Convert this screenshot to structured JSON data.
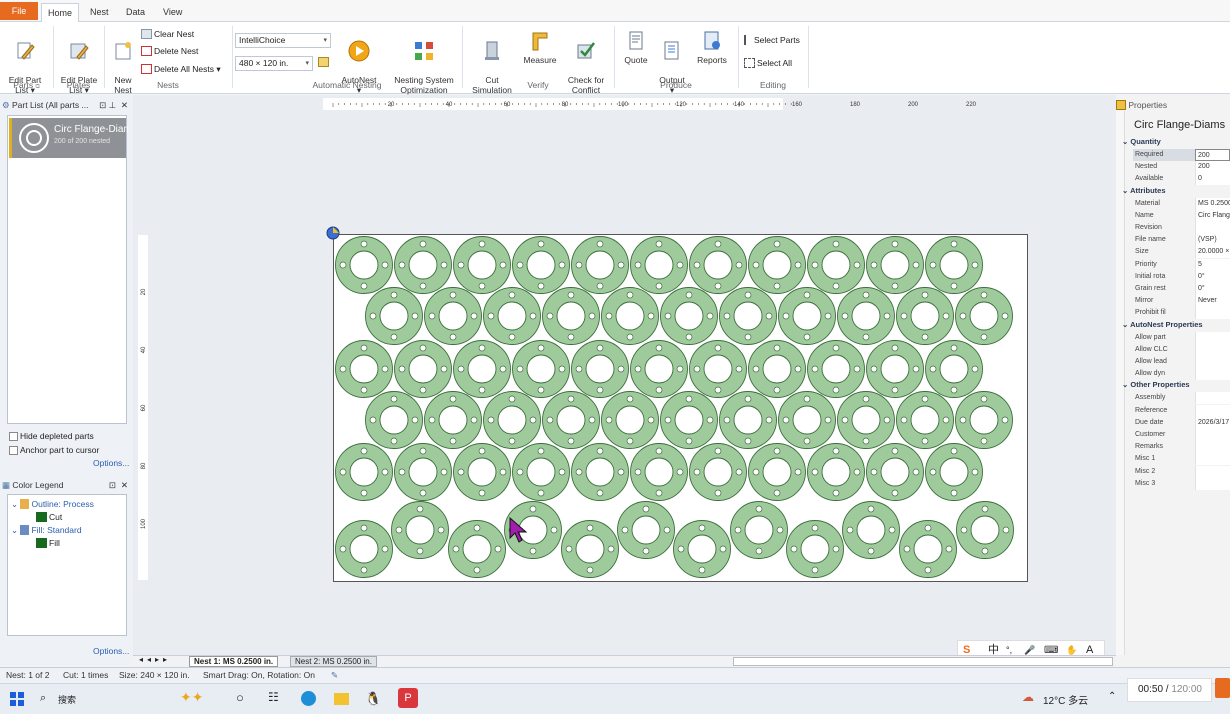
{
  "tabs": {
    "file": "File",
    "home": "Home",
    "nest": "Nest",
    "data": "Data",
    "view": "View"
  },
  "ribbon": {
    "edit_part": "Edit Part\nList ▾",
    "edit_plate": "Edit Plate\nList ▾",
    "new_nest": "New\nNest",
    "clear_nest": "Clear Nest",
    "delete_nest": "Delete Nest",
    "delete_all": "Delete All Nests",
    "strategy": "IntelliChoice",
    "sheet_size": "480 × 120 in.",
    "autonest": "AutoNest\n▾",
    "nesting_opt": "Nesting System\nOptimization",
    "cut_sim": "Cut\nSimulation",
    "measure": "Measure",
    "check_conflict": "Check for\nConflict",
    "quote": "Quote",
    "output": "Output\n▾",
    "reports": "Reports",
    "select_parts": "Select Parts",
    "select_all": "Select All",
    "groups": {
      "parts": "Parts",
      "plates": "Plates",
      "nests": "Nests",
      "automatic": "Automatic Nesting",
      "verify": "Verify",
      "produce": "Produce",
      "editing": "Editing"
    }
  },
  "part_list": {
    "title": "Part List  (All parts ...",
    "item_name": "Circ Flange-Diam",
    "item_status": "200 of 200 nested",
    "hide_depleted": "Hide depleted parts",
    "anchor": "Anchor part to cursor",
    "options": "Options..."
  },
  "legend": {
    "title": "Color Legend",
    "outline": "Outline: Process",
    "cut": "Cut",
    "fill": "Fill: Standard",
    "fill_item": "Fill",
    "options": "Options..."
  },
  "ruler": {
    "x_ticks": [
      "20",
      "40",
      "60",
      "80",
      "100",
      "120",
      "140",
      "160",
      "180",
      "200",
      "220"
    ],
    "y_ticks": [
      "20",
      "40",
      "60",
      "80",
      "100"
    ]
  },
  "properties": {
    "header": "Properties",
    "part_name": "Circ Flange-Diams",
    "sections": [
      {
        "title": "Quantity",
        "rows": [
          [
            "Required",
            "200"
          ],
          [
            "Nested",
            "200"
          ],
          [
            "Available",
            "0"
          ]
        ]
      },
      {
        "title": "Attributes",
        "rows": [
          [
            "Material",
            "MS 0.2500"
          ],
          [
            "Name",
            "Circ Flange"
          ],
          [
            "Revision",
            ""
          ],
          [
            "File name",
            "(VSP)"
          ],
          [
            "Size",
            "20.0000 ×"
          ],
          [
            "Priority",
            "5"
          ],
          [
            "Initial rota",
            "0°"
          ],
          [
            "Grain rest",
            "0°"
          ],
          [
            "Mirror",
            "Never"
          ],
          [
            "Prohibit fil",
            ""
          ]
        ]
      },
      {
        "title": "AutoNest Properties",
        "rows": [
          [
            "Allow part",
            ""
          ],
          [
            "Allow CLC",
            ""
          ],
          [
            "Allow lead",
            ""
          ],
          [
            "Allow dyn",
            ""
          ]
        ]
      },
      {
        "title": "Other Properties",
        "rows": [
          [
            "Assembly",
            ""
          ],
          [
            "Reference",
            ""
          ],
          [
            "Due date",
            "2026/3/17"
          ],
          [
            "Customer",
            ""
          ],
          [
            "Remarks",
            ""
          ],
          [
            "Misc 1",
            ""
          ],
          [
            "Misc 2",
            ""
          ],
          [
            "Misc 3",
            ""
          ]
        ]
      }
    ]
  },
  "nest_tabs": {
    "nest1": "Nest 1: MS 0.2500 in.",
    "nest2": "Nest 2: MS 0.2500 in."
  },
  "status": {
    "nest": "Nest: 1 of 2",
    "cut": "Cut: 1 times",
    "size": "Size: 240 × 120 in.",
    "drag": "Smart Drag: On, Rotation: On"
  },
  "ime": {
    "chars": [
      "中",
      "°,",
      "🎤",
      "⌨",
      "✋",
      "A"
    ]
  },
  "taskbar": {
    "search": "搜索",
    "weather": "12°C 多云",
    "video_time": "00:50",
    "video_total": "120:00"
  },
  "colors": {
    "part_fill": "#9fcb9c",
    "part_stroke": "#3c6e3c",
    "accent": "#e66a1f"
  }
}
